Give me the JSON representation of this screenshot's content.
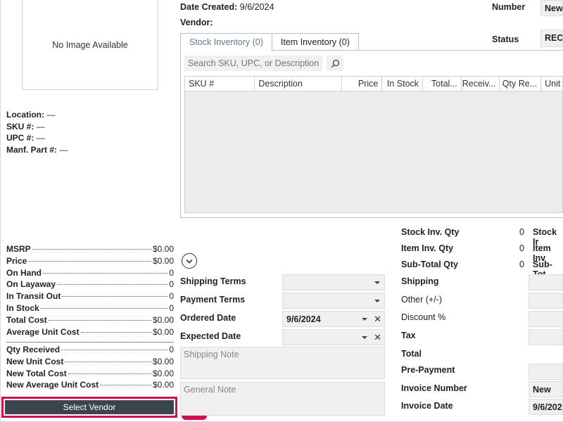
{
  "product": {
    "image_placeholder": "No Image Available",
    "location_label": "Location:",
    "location_value": "—",
    "sku_label": "SKU #:",
    "sku_value": "—",
    "upc_label": "UPC #:",
    "upc_value": "—",
    "manf_label": "Manf. Part #:",
    "manf_value": "—"
  },
  "stats": [
    {
      "label": "MSRP",
      "value": "$0.00"
    },
    {
      "label": "Price",
      "value": "$0.00"
    },
    {
      "label": "On Hand",
      "value": "0"
    },
    {
      "label": "On Layaway",
      "value": "0"
    },
    {
      "label": "In Transit Out",
      "value": "0"
    },
    {
      "label": "In Stock",
      "value": "0"
    },
    {
      "label": "Total Cost",
      "value": "$0.00"
    },
    {
      "label": "Average Unit Cost",
      "value": "$0.00"
    }
  ],
  "receive_stats": [
    {
      "label": "Qty Received",
      "value": "0"
    },
    {
      "label": "New Unit Cost",
      "value": "$0.00"
    },
    {
      "label": "New Total Cost",
      "value": "$0.00"
    },
    {
      "label": "New Average Unit Cost",
      "value": "$0.00"
    }
  ],
  "select_vendor_label": "Select Vendor",
  "header": {
    "date_created_label": "Date Created:",
    "date_created_value": "9/6/2024",
    "vendor_label": "Vendor:",
    "number_label": "Number",
    "number_value": "New",
    "status_label": "Status",
    "status_value": "RECI"
  },
  "tabs": [
    {
      "label": "Stock Inventory (0)",
      "active": true
    },
    {
      "label": "Item Inventory (0)",
      "active": false
    }
  ],
  "search": {
    "placeholder": "Search SKU, UPC, or Description"
  },
  "grid_columns": [
    "SKU #",
    "Description",
    "Price",
    "In Stock",
    "Total...",
    "Receiv...",
    "Qty Re...",
    "Unit"
  ],
  "form": {
    "shipping_terms_label": "Shipping Terms",
    "payment_terms_label": "Payment Terms",
    "ordered_date_label": "Ordered Date",
    "ordered_date_value": "9/6/2024",
    "expected_date_label": "Expected Date",
    "shipping_note_placeholder": "Shipping Note",
    "general_note_placeholder": "General Note"
  },
  "summary": {
    "stock_inv_qty_label": "Stock Inv. Qty",
    "stock_inv_qty_value": "0",
    "stock_inv_trunc": "Stock Ir",
    "item_inv_qty_label": "Item Inv. Qty",
    "item_inv_qty_value": "0",
    "item_inv_trunc": "Item Inv",
    "subtotal_qty_label": "Sub-Total Qty",
    "subtotal_qty_value": "0",
    "subtotal_trunc": "Sub-Tot",
    "shipping_label": "Shipping",
    "other_label": "Other (+/-)",
    "discount_label": "Discount %",
    "tax_label": "Tax",
    "total_label": "Total",
    "prepayment_label": "Pre-Payment",
    "invoice_number_label": "Invoice Number",
    "invoice_number_value": "New",
    "invoice_date_label": "Invoice Date",
    "invoice_date_value": "9/6/202"
  },
  "colors": {
    "accent": "#d0104c",
    "button_dark": "#3a4550",
    "tab_active_text": "#5a7d92"
  },
  "icons": {
    "search": "search-icon",
    "mouse": "mouse-icon",
    "expand": "chevron-down-circle-icon"
  }
}
